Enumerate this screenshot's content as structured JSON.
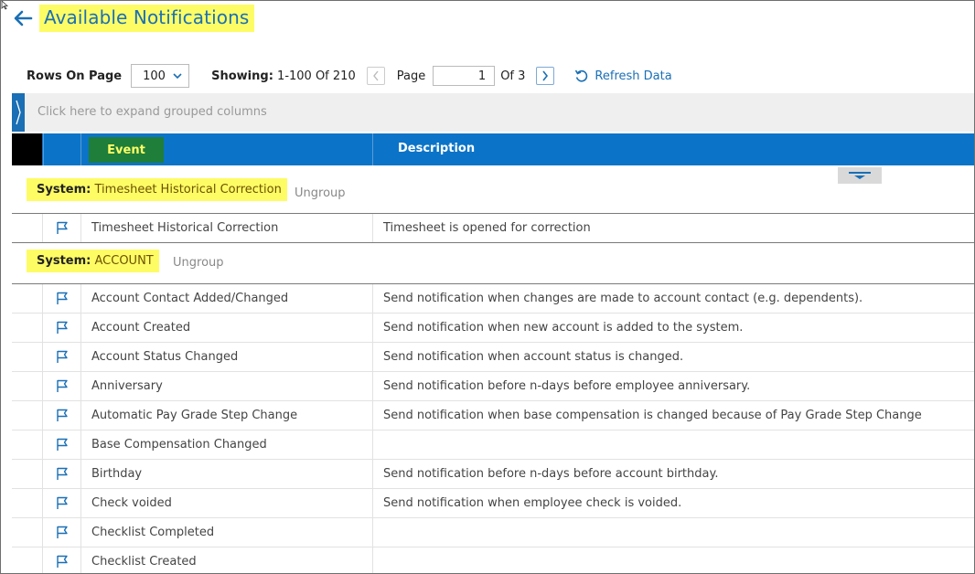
{
  "header": {
    "title": "Available Notifications"
  },
  "icons": {
    "back": "arrow-left-icon",
    "refresh": "refresh-icon",
    "flag": "flag-icon"
  },
  "toolbar": {
    "rows_label": "Rows On Page",
    "rows_value": "100",
    "showing_label": "Showing:",
    "showing_value": "1-100 Of 210",
    "page_label": "Page",
    "page_value": "1",
    "of_label": "Of 3",
    "refresh_label": "Refresh Data"
  },
  "group_bar": {
    "hint": "Click here to expand grouped columns"
  },
  "grid": {
    "columns": {
      "event": "Event",
      "description": "Description"
    },
    "groups": [
      {
        "prefix": "System:",
        "name": "Timesheet Historical Correction",
        "ungroup_label": "Ungroup",
        "rows": [
          {
            "event": "Timesheet Historical Correction",
            "description": "Timesheet is opened for correction"
          }
        ]
      },
      {
        "prefix": "System:",
        "name": "ACCOUNT",
        "ungroup_label": "Ungroup",
        "rows": [
          {
            "event": "Account Contact Added/Changed",
            "description": "Send notification when changes are made to account contact (e.g. dependents)."
          },
          {
            "event": "Account Created",
            "description": "Send notification when new account is added to the system."
          },
          {
            "event": "Account Status Changed",
            "description": "Send notification when account status is changed."
          },
          {
            "event": "Anniversary",
            "description": "Send notification before n-days before employee anniversary."
          },
          {
            "event": "Automatic Pay Grade Step Change",
            "description": "Send notification when base compensation is changed because of Pay Grade Step Change"
          },
          {
            "event": "Base Compensation Changed",
            "description": ""
          },
          {
            "event": "Birthday",
            "description": "Send notification before n-days before account birthday."
          },
          {
            "event": "Check voided",
            "description": "Send notification when employee check is voided."
          },
          {
            "event": "Checklist Completed",
            "description": ""
          },
          {
            "event": "Checklist Created",
            "description": ""
          }
        ]
      }
    ]
  },
  "colors": {
    "accent_blue": "#0b74c8",
    "highlight_yellow": "#fefc65",
    "event_header_green": "#1e7e3a"
  }
}
